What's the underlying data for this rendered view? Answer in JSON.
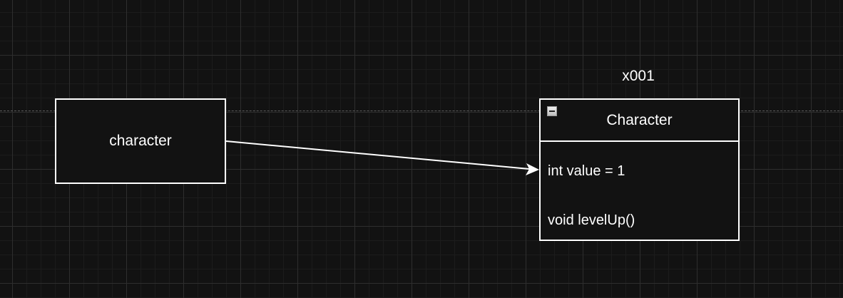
{
  "diagram": {
    "reference": {
      "label": "character"
    },
    "object": {
      "address_label": "x001",
      "class_name": "Character",
      "members": [
        "int value = 1",
        "void levelUp()"
      ]
    },
    "colors": {
      "background": "#121212",
      "stroke": "#ffffff",
      "grid": "#2e2e2e",
      "guide": "#5a5a5a"
    },
    "icons": {
      "collapse": "collapse-minus-icon"
    }
  }
}
